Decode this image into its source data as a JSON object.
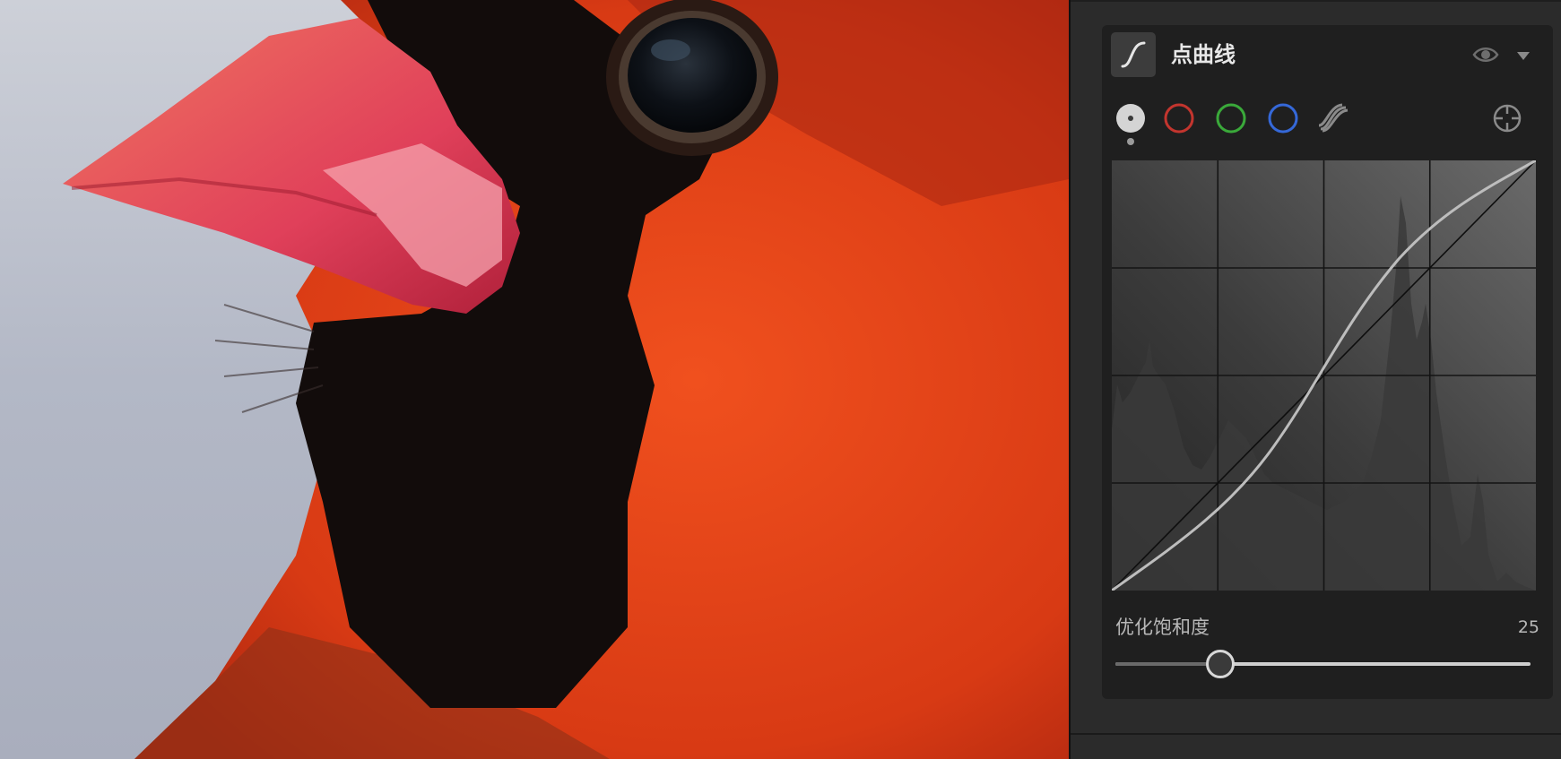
{
  "photo": {
    "subject": "northern-cardinal-closeup"
  },
  "panel": {
    "title": "点曲线",
    "icons": {
      "curve": "point-curve-icon",
      "visibility": "eye-icon",
      "collapse": "triangle-down-icon",
      "target": "targeted-adjustment-icon"
    }
  },
  "channels": [
    {
      "id": "rgb",
      "icon": "white-dot-channel-icon",
      "color": "#d0d0d0",
      "active": true
    },
    {
      "id": "red",
      "icon": "red-circle-icon",
      "color": "#c3352e"
    },
    {
      "id": "green",
      "icon": "green-circle-icon",
      "color": "#3aa93a"
    },
    {
      "id": "blue",
      "icon": "blue-circle-icon",
      "color": "#3568d8"
    },
    {
      "id": "parametric",
      "icon": "parametric-curve-icon",
      "color": "#8a8a8a"
    }
  ],
  "curve": {
    "grid": "4x4",
    "histogram": true,
    "tone_curve_points": [
      [
        0,
        0
      ],
      [
        0.25,
        0.22
      ],
      [
        0.5,
        0.5
      ],
      [
        0.75,
        0.8
      ],
      [
        1,
        1
      ]
    ]
  },
  "slider": {
    "label": "优化饱和度",
    "value": "25",
    "fraction": 0.25
  }
}
